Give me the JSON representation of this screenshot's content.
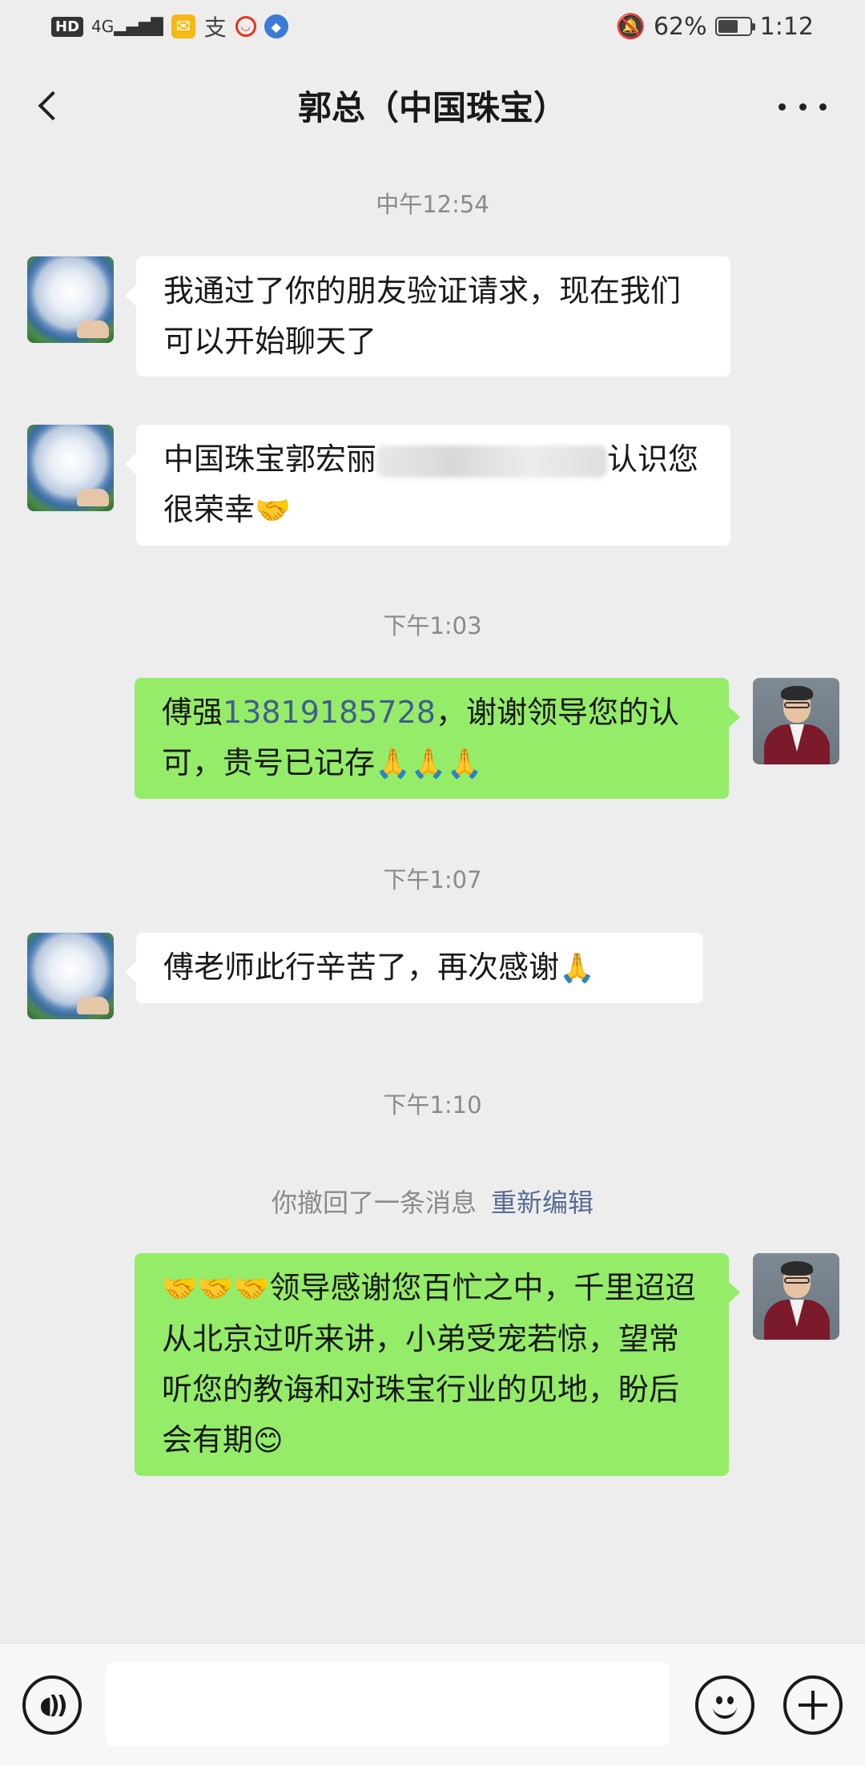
{
  "status_bar": {
    "hd": "HD",
    "signal": "4G",
    "alipay_char": "支",
    "battery_percent_label": "62%",
    "battery_level": 0.62,
    "time": "1:12"
  },
  "header": {
    "title": "郭总（中国珠宝）"
  },
  "messages": {
    "ts1": "中午12:54",
    "m1": "我通过了你的朋友验证请求，现在我们可以开始聊天了",
    "m2_prefix": "中国珠宝郭宏丽",
    "m2_blurred": "13851000000",
    "m2_suffix": "认识您很荣幸",
    "m2_emoji": "🤝",
    "ts2": "下午1:03",
    "m3_prefix": "傅强",
    "m3_phone": "13819185728",
    "m3_suffix": "，谢谢领导您的认可，贵号已记存",
    "m3_emoji": "🙏🙏🙏",
    "ts3": "下午1:07",
    "m4_text": "傅老师此行辛苦了，再次感谢",
    "m4_emoji": "🙏",
    "ts4": "下午1:10",
    "recall_text": "你撤回了一条消息",
    "recall_action": "重新编辑",
    "m5_emoji": "🤝🤝🤝",
    "m5_text": "领导感谢您百忙之中，千里迢迢从北京过听来讲，小弟受宠若惊，望常听您的教诲和对珠宝行业的见地，盼后会有期",
    "m5_end_emoji": "😊"
  },
  "input_bar": {
    "voice_icon": "voice-icon",
    "emoji_icon": "emoji-icon",
    "plus_icon": "plus-icon"
  }
}
